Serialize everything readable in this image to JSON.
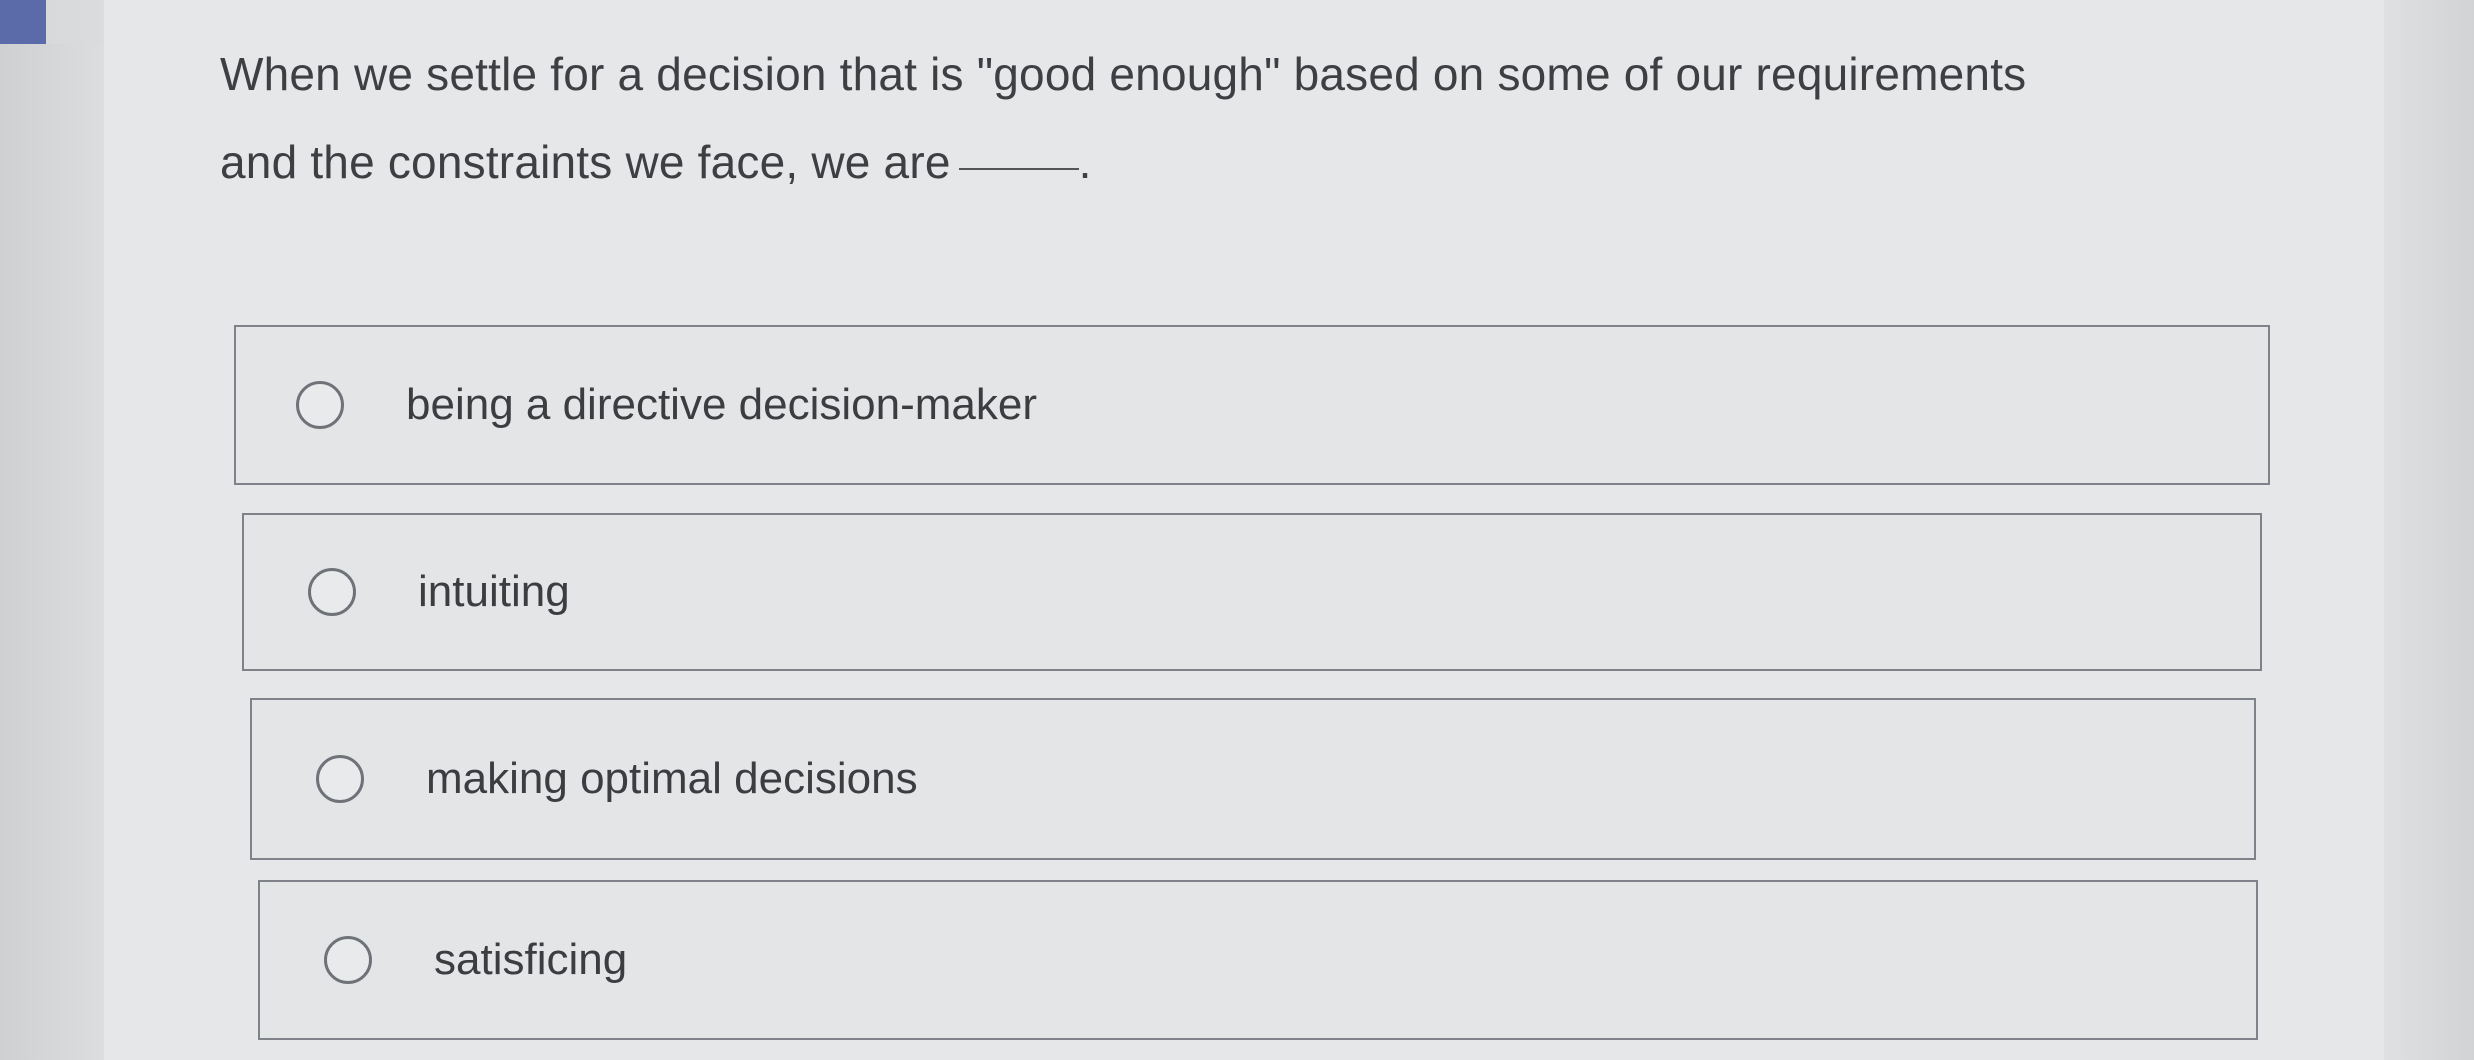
{
  "question": {
    "text_line1": "When we settle for a decision that is \"good enough\" based on some of our requirements",
    "text_line2": "and the constraints we face, we are",
    "text_end": "."
  },
  "options": [
    {
      "label": "being a directive decision-maker",
      "selected": false
    },
    {
      "label": "intuiting",
      "selected": false
    },
    {
      "label": "making optimal decisions",
      "selected": false
    },
    {
      "label": "satisficing",
      "selected": false
    }
  ],
  "colors": {
    "accent": "#5b6aa8",
    "background": "#e6e7e9",
    "text": "#3d3f43",
    "border": "#7f8389"
  }
}
